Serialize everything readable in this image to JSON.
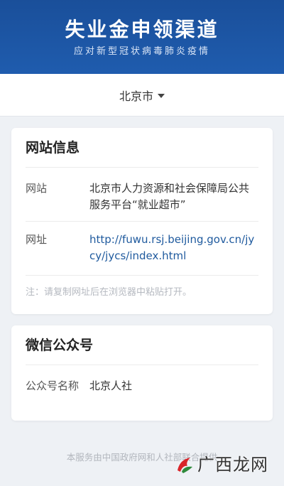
{
  "header": {
    "title": "失业金申领渠道",
    "subtitle": "应对新型冠状病毒肺炎疫情"
  },
  "city_selector": {
    "value": "北京市"
  },
  "website_card": {
    "title": "网站信息",
    "site_label": "网站",
    "site_value": "北京市人力资源和社会保障局公共服务平台“就业超市”",
    "url_label": "网址",
    "url_value": "http://fuwu.rsj.beijing.gov.cn/jycy/jycs/index.html",
    "note": "注：请复制网址后在浏览器中粘贴打开。"
  },
  "wechat_card": {
    "title": "微信公众号",
    "account_label": "公众号名称",
    "account_value": "北京人社"
  },
  "footer": {
    "note": "本服务由中国政府网和人社部联合提供"
  },
  "watermark": {
    "text": "广西龙网",
    "icon": "dragon-logo-icon"
  },
  "colors": {
    "banner": "#1f5cae",
    "link": "#1f5a9e",
    "background": "#eef1f5"
  }
}
